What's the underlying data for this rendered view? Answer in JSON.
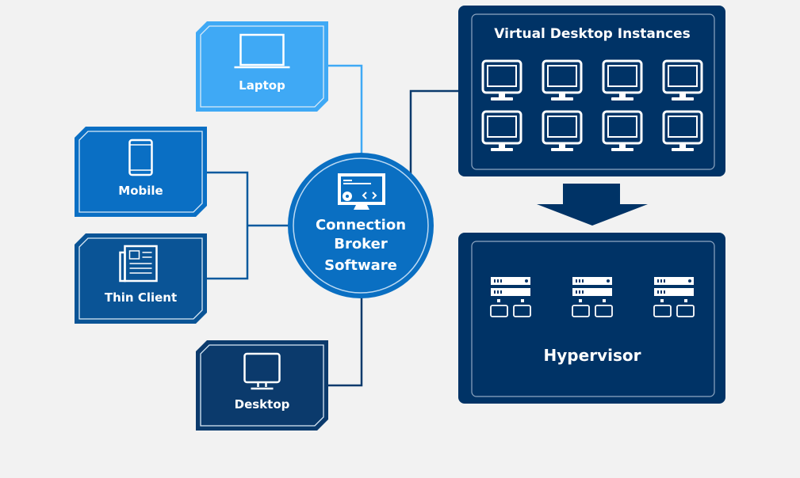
{
  "devices": [
    {
      "label": "Laptop",
      "icon": "laptop-icon",
      "color": "#3fa9f5"
    },
    {
      "label": "Mobile",
      "icon": "mobile-icon",
      "color": "#0a6fc4"
    },
    {
      "label": "Thin Client",
      "icon": "newspaper-icon",
      "color": "#0a5496"
    },
    {
      "label": "Desktop",
      "icon": "monitor-icon",
      "color": "#0b3a6c"
    }
  ],
  "broker": {
    "line1": "Connection",
    "line2": "Broker",
    "line3": "Software",
    "icon": "monitor-code-gear-icon",
    "color": "#0a6fc2"
  },
  "vdi": {
    "title": "Virtual Desktop Instances",
    "color": "#003366",
    "instance_count": 8
  },
  "hypervisor": {
    "title": "Hypervisor",
    "color": "#003366",
    "server_count": 3
  },
  "colors": {
    "background": "#f2f2f2",
    "navy": "#003366"
  }
}
